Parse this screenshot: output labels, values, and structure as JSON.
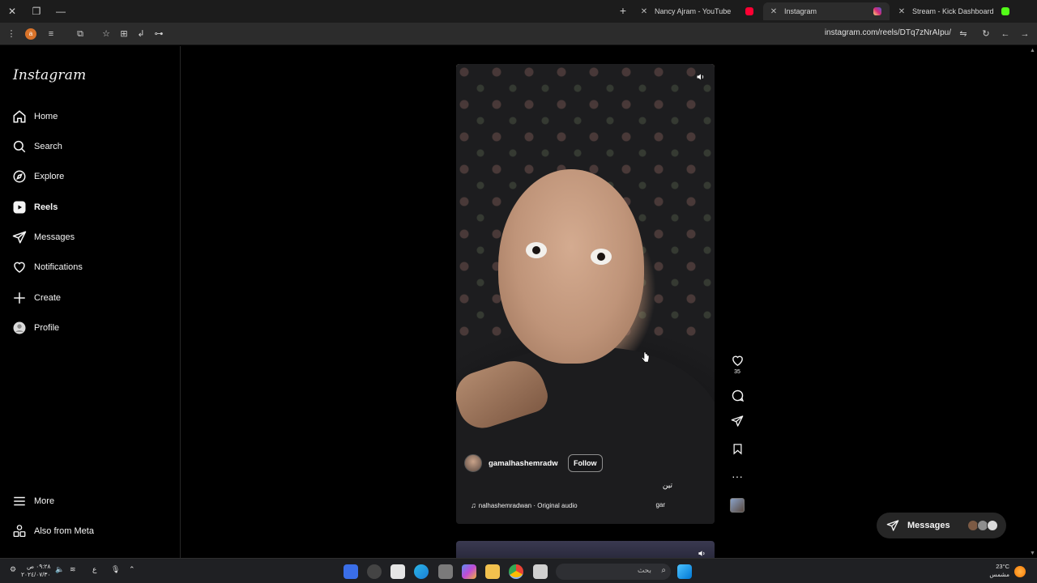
{
  "browser": {
    "tabs": [
      {
        "label": "Nancy Ajram - YouTube",
        "favicon_color": "#ff0033",
        "active": false
      },
      {
        "label": "Instagram",
        "favicon_color": "#d62976",
        "active": true
      },
      {
        "label": "Stream - Kick Dashboard",
        "favicon_color": "#53fc18",
        "active": false
      }
    ],
    "url": "instagram.com/reels/DTq7zNrAIpu/",
    "toolbar_icons": [
      "menu-icon",
      "extension-icon",
      "reading-list-icon",
      "extensions-icon",
      "star-icon",
      "collections-icon",
      "share-icon",
      "read-aloud-icon"
    ],
    "nav_icons": [
      "tune-icon",
      "reload-icon",
      "back-icon",
      "forward-icon"
    ]
  },
  "sidebar": {
    "logo": "Instagram",
    "items": [
      {
        "label": "Home",
        "icon": "home-icon"
      },
      {
        "label": "Search",
        "icon": "search-icon"
      },
      {
        "label": "Explore",
        "icon": "compass-icon"
      },
      {
        "label": "Reels",
        "icon": "reels-icon",
        "active": true
      },
      {
        "label": "Messages",
        "icon": "messenger-icon"
      },
      {
        "label": "Notifications",
        "icon": "heart-icon"
      },
      {
        "label": "Create",
        "icon": "plus-icon"
      },
      {
        "label": "Profile",
        "icon": "avatar-icon"
      }
    ],
    "bottom": [
      {
        "label": "More",
        "icon": "hamburger-icon"
      },
      {
        "label": "Also from Meta",
        "icon": "meta-apps-icon"
      }
    ]
  },
  "reel": {
    "username": "gamalhashemradwan",
    "follow_label": "Follow",
    "caption": "تين",
    "audio_text": "nalhashemradwan · Original audio",
    "audio_extra": "gar",
    "like_count": "35"
  },
  "messages_pill": {
    "label": "Messages"
  },
  "taskbar": {
    "search_placeholder": "بحث",
    "clock_time": "٠٩:٢٨ ص",
    "clock_date": "٢٠٢٤/٠٧/٣٠",
    "weather_temp": "23°C",
    "weather_desc": "مشمس",
    "lang": "ع"
  },
  "colors": {
    "background": "#000000",
    "sidebar_border": "#262626",
    "pill": "#262626"
  }
}
